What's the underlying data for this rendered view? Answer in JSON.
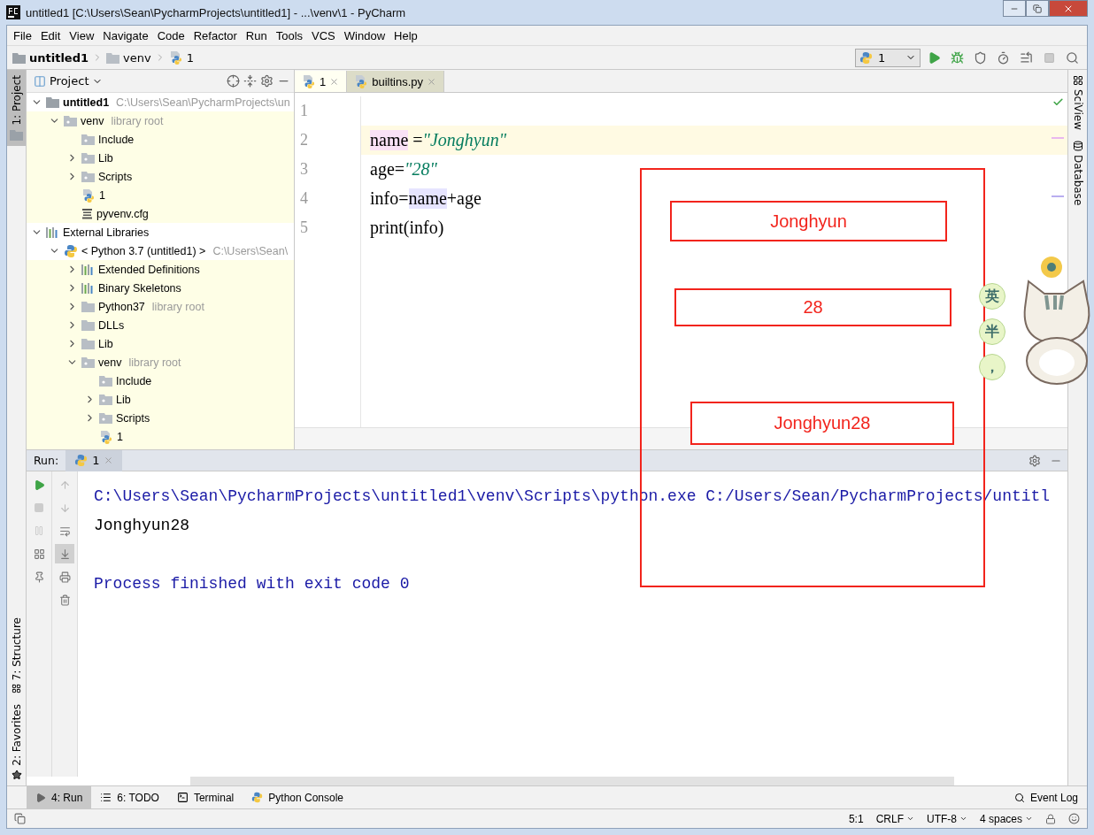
{
  "window": {
    "title": "untitled1 [C:\\Users\\Sean\\PycharmProjects\\untitled1] - ...\\venv\\1 - PyCharm"
  },
  "menu": [
    "File",
    "Edit",
    "View",
    "Navigate",
    "Code",
    "Refactor",
    "Run",
    "Tools",
    "VCS",
    "Window",
    "Help"
  ],
  "breadcrumb": [
    {
      "label": "untitled1",
      "kind": "root"
    },
    {
      "label": "venv",
      "kind": "folder"
    },
    {
      "label": "1",
      "kind": "python-file"
    }
  ],
  "run_config": {
    "label": "1"
  },
  "left_stripe": [
    {
      "label": "1: Project",
      "selected": true,
      "kind": "project"
    },
    {
      "label": "7: Structure",
      "selected": false,
      "kind": "structure"
    },
    {
      "label": "2: Favorites",
      "selected": false,
      "kind": "favorites"
    }
  ],
  "right_stripe": [
    {
      "label": "SciView",
      "kind": "sciview"
    },
    {
      "label": "Database",
      "kind": "database"
    }
  ],
  "project": {
    "title": "Project",
    "tree": [
      {
        "label": "untitled1",
        "hint": "C:\\Users\\Sean\\PycharmProjects\\un",
        "kind": "root",
        "expanded": true,
        "tinted": false,
        "children": [
          {
            "label": "venv",
            "hint": "library root",
            "kind": "source-folder",
            "expanded": true,
            "tinted": true,
            "children": [
              {
                "label": "Include",
                "kind": "source-folder",
                "tinted": true
              },
              {
                "label": "Lib",
                "kind": "source-folder",
                "expanded": false,
                "tinted": true
              },
              {
                "label": "Scripts",
                "kind": "source-folder",
                "expanded": false,
                "tinted": true
              },
              {
                "label": "1",
                "kind": "python-file",
                "tinted": true
              },
              {
                "label": "pyvenv.cfg",
                "kind": "config-file",
                "tinted": true
              }
            ]
          }
        ]
      },
      {
        "label": "External Libraries",
        "kind": "library",
        "expanded": true,
        "tinted": false,
        "children": [
          {
            "label": "< Python 3.7 (untitled1) >",
            "hint": "C:\\Users\\Sean\\",
            "kind": "python",
            "expanded": true,
            "tinted": false,
            "children": [
              {
                "label": "Extended Definitions",
                "kind": "library",
                "expanded": false,
                "tinted": true
              },
              {
                "label": "Binary Skeletons",
                "kind": "library",
                "expanded": false,
                "tinted": true
              },
              {
                "label": "Python37",
                "hint": "library root",
                "kind": "folder",
                "expanded": false,
                "tinted": true
              },
              {
                "label": "DLLs",
                "kind": "folder",
                "expanded": false,
                "tinted": true
              },
              {
                "label": "Lib",
                "kind": "folder",
                "expanded": false,
                "tinted": true
              },
              {
                "label": "venv",
                "hint": "library root",
                "kind": "source-folder",
                "expanded": true,
                "tinted": true,
                "children": [
                  {
                    "label": "Include",
                    "kind": "source-folder",
                    "tinted": true
                  },
                  {
                    "label": "Lib",
                    "kind": "source-folder",
                    "expanded": false,
                    "tinted": true
                  },
                  {
                    "label": "Scripts",
                    "kind": "source-folder",
                    "expanded": false,
                    "tinted": true
                  },
                  {
                    "label": "1",
                    "kind": "python-file",
                    "tinted": true
                  }
                ]
              }
            ]
          }
        ]
      }
    ]
  },
  "editor": {
    "tabs": [
      {
        "label": "1",
        "kind": "python-file",
        "selected": true
      },
      {
        "label": "builtins.py",
        "kind": "python-file",
        "selected": false
      }
    ],
    "lines": [
      {
        "number": "1",
        "current": false
      },
      {
        "number": "2",
        "current": true,
        "segments": [
          {
            "text": "name",
            "kind": "write-highlight"
          },
          {
            "text": " =",
            "kind": "plain"
          },
          {
            "text": "\"Jonghyun\"",
            "kind": "string"
          }
        ]
      },
      {
        "number": "3",
        "current": false,
        "segments": [
          {
            "text": "age=",
            "kind": "plain"
          },
          {
            "text": "\"28\"",
            "kind": "string"
          }
        ]
      },
      {
        "number": "4",
        "current": false,
        "segments": [
          {
            "text": "info=",
            "kind": "plain"
          },
          {
            "text": "name",
            "kind": "read-highlight"
          },
          {
            "text": "+age",
            "kind": "plain"
          }
        ]
      },
      {
        "number": "5",
        "current": false,
        "segments": [
          {
            "text": "print(info)",
            "kind": "plain"
          }
        ]
      }
    ]
  },
  "run": {
    "label": "Run:",
    "tabs": [
      {
        "label": "1",
        "selected": true
      }
    ],
    "console": [
      {
        "text": "C:\\Users\\Sean\\PycharmProjects\\untitled1\\venv\\Scripts\\python.exe C:/Users/Sean/PycharmProjects/untitl",
        "kind": "command"
      },
      {
        "text": "Jonghyun28",
        "kind": "output"
      },
      {
        "text": "Process finished with exit code 0",
        "kind": "exit"
      }
    ]
  },
  "bottom_tools": [
    {
      "label": "4: Run",
      "kind": "run",
      "selected": true
    },
    {
      "label": "6: TODO",
      "kind": "todo",
      "selected": false
    },
    {
      "label": "Terminal",
      "kind": "terminal",
      "selected": false
    },
    {
      "label": "Python Console",
      "kind": "console",
      "selected": false
    }
  ],
  "event_log": "Event Log",
  "status": [
    "5:1",
    "CRLF",
    "UTF-8",
    "4 spaces"
  ],
  "annotations": [
    "Jonghyun",
    "28",
    "Jonghyun28"
  ],
  "ime": [
    "英",
    "半",
    "，"
  ]
}
